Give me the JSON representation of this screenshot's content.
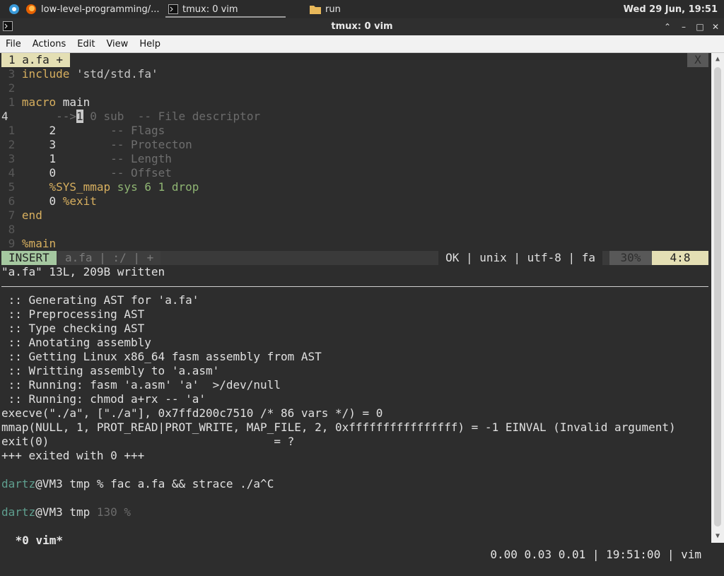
{
  "panel": {
    "task1_label": "low-level-programming/...",
    "task2_label": "tmux: 0 vim",
    "task3_label": "run",
    "clock": "Wed 29 Jun, 19:51"
  },
  "window": {
    "title": "tmux: 0 vim"
  },
  "menu": {
    "file": "File",
    "actions": "Actions",
    "edit": "Edit",
    "view": "View",
    "help": "Help"
  },
  "vim": {
    "tab_label": "1 a.fa +",
    "tab_close": "X",
    "lines": [
      {
        "num": "3",
        "text": "include 'std/std.fa'"
      },
      {
        "num": "2",
        "text": ""
      },
      {
        "num": "1",
        "text": "macro main"
      },
      {
        "num": "4",
        "text": "    -->1 0 sub  -- File descriptor"
      },
      {
        "num": "1",
        "text": "    2        -- Flags"
      },
      {
        "num": "2",
        "text": "    3        -- Protecton"
      },
      {
        "num": "3",
        "text": "    1        -- Length"
      },
      {
        "num": "4",
        "text": "    0        -- Offset"
      },
      {
        "num": "5",
        "text": "    %SYS_mmap sys 6 1 drop"
      },
      {
        "num": "6",
        "text": "    0 %exit"
      },
      {
        "num": "7",
        "text": "end"
      },
      {
        "num": "8",
        "text": ""
      },
      {
        "num": "9",
        "text": "%main"
      }
    ],
    "status": {
      "mode": "INSERT",
      "file_info": "a.fa | :/ | +",
      "right_info": "OK | unix | utf-8 | fa",
      "percent": "30%",
      "position": "4:8"
    },
    "message": "\"a.fa\" 13L, 209B written"
  },
  "shell": {
    "lines": [
      " :: Generating AST for 'a.fa'",
      " :: Preprocessing AST",
      " :: Type checking AST",
      " :: Anotating assembly",
      " :: Getting Linux x86_64 fasm assembly from AST",
      " :: Writting assembly to 'a.asm'",
      " :: Running: fasm 'a.asm' 'a'  >/dev/null",
      " :: Running: chmod a+rx -- 'a'",
      "execve(\"./a\", [\"./a\"], 0x7ffd200c7510 /* 86 vars */) = 0",
      "mmap(NULL, 1, PROT_READ|PROT_WRITE, MAP_FILE, 2, 0xffffffffffffffff) = -1 EINVAL (Invalid argument)",
      "exit(0)                                 = ?",
      "+++ exited with 0 +++",
      ""
    ],
    "prompt1_user": "dartz",
    "prompt1_rest": "@VM3 tmp % fac a.fa && strace ./a^C",
    "prompt2_user": "dartz",
    "prompt2_host": "@VM3 tmp ",
    "prompt2_code": "130 %"
  },
  "tmux": {
    "window": " *0 vim*",
    "right": "0.00 0.03 0.01 | 19:51:00 | vim"
  }
}
